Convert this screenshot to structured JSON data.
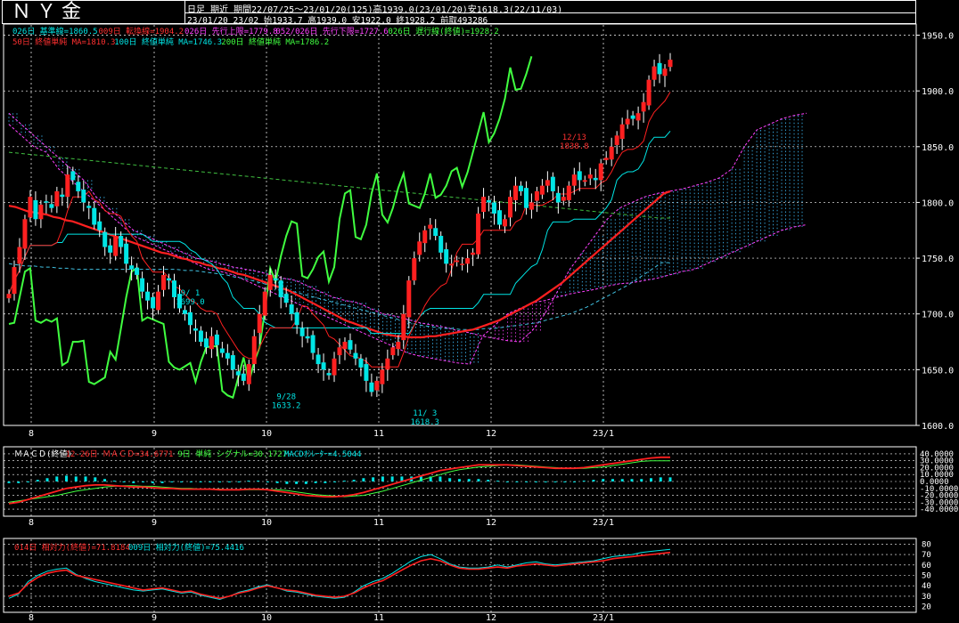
{
  "header": {
    "title": "ＮＹ金",
    "line1": "日足 期近 期間22/07/25～23/01/20(125)高1939.0(23/01/20)安1618.3(22/11/03)",
    "line2": "23/01/20 23/02 始1933.7 高1939.0 安1922.0 終1928.2 前取493286"
  },
  "main_legend": {
    "row1": [
      {
        "text": "026日 基準線=1860.5",
        "color": "#00e5e5"
      },
      {
        "text": "009日 転換線=1904.2",
        "color": "#ff3030"
      },
      {
        "text": "026日 先行上限=1779.8",
        "color": "#ff40ff"
      },
      {
        "text": "052/026日 先行下限=1727.6",
        "color": "#ff40ff"
      },
      {
        "text": "026日 遅行線(終値)=1928.2",
        "color": "#40ff40"
      }
    ],
    "row2": [
      {
        "text": "50日 終値単純 MA=1810.3",
        "color": "#ff3030"
      },
      {
        "text": "100日 終値単純 MA=1746.3",
        "color": "#00e5e5"
      },
      {
        "text": "200日 終値単純 MA=1786.2",
        "color": "#40ff40"
      }
    ]
  },
  "annotations": [
    {
      "text": "12/13",
      "sub": "1838.8",
      "color": "#ff3030",
      "date": "12/13",
      "price": 1838.8
    },
    {
      "text": "9/ 1",
      "sub": "1699.0",
      "color": "#00e5e5",
      "date": "9/1",
      "price": 1699.0
    },
    {
      "text": "9/28",
      "sub": "1633.2",
      "color": "#00e5e5",
      "date": "9/28",
      "price": 1633.2
    },
    {
      "text": "11/ 3",
      "sub": "1618.3",
      "color": "#00e5e5",
      "date": "11/3",
      "price": 1618.3
    }
  ],
  "macd_legend": [
    {
      "text": "ＭＡＣＤ(終値)",
      "color": "#ffffff"
    },
    {
      "text": "12-26日 ＭＡＣＤ=34.6771",
      "color": "#ff3030"
    },
    {
      "text": "9日 単純 シグナル=30.1727",
      "color": "#40ff40"
    },
    {
      "text": "MACDｵｼﾚｰﾀｰ=4.5044",
      "color": "#00e5e5"
    }
  ],
  "rsi_legend": [
    {
      "text": "014日 相対力(終値)=71.8184",
      "color": "#ff3030"
    },
    {
      "text": "009日 相対力(終値)=75.4416",
      "color": "#00e5e5"
    }
  ],
  "colors": {
    "up": "#ff2020",
    "down": "#00e5e5",
    "cloud": "#ff40ff",
    "lag": "#40ff40",
    "grid": "#ffffff"
  },
  "chart_data": [
    {
      "type": "candlestick",
      "title": "ＮＹ金",
      "x_ticks": [
        "8",
        "9",
        "10",
        "11",
        "12",
        "23/1"
      ],
      "y_ticks": [
        "1950.0",
        "1900.0",
        "1850.0",
        "1800.0",
        "1750.0",
        "1700.0",
        "1650.0",
        "1600.0"
      ],
      "ylim": [
        1600,
        1960
      ],
      "closes": [
        1718,
        1742,
        1760,
        1785,
        1805,
        1785,
        1798,
        1800,
        1795,
        1810,
        1805,
        1825,
        1820,
        1810,
        1800,
        1795,
        1780,
        1775,
        1760,
        1755,
        1770,
        1760,
        1745,
        1740,
        1735,
        1720,
        1712,
        1705,
        1720,
        1735,
        1730,
        1715,
        1705,
        1700,
        1690,
        1685,
        1675,
        1670,
        1680,
        1672,
        1665,
        1660,
        1650,
        1645,
        1640,
        1655,
        1680,
        1700,
        1720,
        1735,
        1730,
        1715,
        1710,
        1700,
        1690,
        1680,
        1678,
        1665,
        1655,
        1650,
        1645,
        1660,
        1670,
        1675,
        1668,
        1660,
        1652,
        1640,
        1630,
        1640,
        1650,
        1660,
        1670,
        1675,
        1700,
        1730,
        1750,
        1765,
        1775,
        1780,
        1770,
        1755,
        1745,
        1745,
        1748,
        1745,
        1750,
        1755,
        1790,
        1805,
        1800,
        1790,
        1780,
        1785,
        1805,
        1815,
        1810,
        1795,
        1800,
        1810,
        1815,
        1820,
        1810,
        1800,
        1805,
        1815,
        1825,
        1820,
        1820,
        1825,
        1820,
        1835,
        1840,
        1850,
        1860,
        1870,
        1875,
        1875,
        1880,
        1890,
        1910,
        1922,
        1915,
        1920,
        1928
      ],
      "ma50": [
        1797,
        1796,
        1794,
        1792,
        1791,
        1790,
        1789,
        1787,
        1786,
        1784,
        1783,
        1781,
        1779,
        1777,
        1775,
        1773,
        1771,
        1769,
        1767,
        1765,
        1763,
        1761,
        1759,
        1757,
        1755,
        1754,
        1752,
        1750,
        1749,
        1747,
        1746,
        1744,
        1743,
        1741,
        1740,
        1738,
        1736,
        1735,
        1733,
        1731,
        1729,
        1727,
        1725,
        1723,
        1721,
        1718,
        1715,
        1712,
        1709,
        1706,
        1703,
        1700,
        1697,
        1694,
        1692,
        1690,
        1688,
        1686,
        1684,
        1682,
        1681,
        1680,
        1680,
        1679,
        1679,
        1679,
        1680,
        1680,
        1681,
        1682,
        1683,
        1684,
        1685,
        1686,
        1688,
        1690,
        1692,
        1694,
        1697,
        1700,
        1703,
        1706,
        1709,
        1712,
        1716,
        1720,
        1724,
        1728,
        1733,
        1738,
        1743,
        1748,
        1753,
        1758,
        1763,
        1768,
        1773,
        1778,
        1783,
        1788,
        1793,
        1798,
        1803,
        1808,
        1810
      ],
      "ma100": [
        1745,
        1744,
        1743,
        1743,
        1742,
        1742,
        1741,
        1741,
        1740,
        1740,
        1740,
        1740,
        1740,
        1740,
        1740,
        1740,
        1740,
        1740,
        1740,
        1740,
        1740,
        1739,
        1739,
        1738,
        1737,
        1736,
        1735,
        1733,
        1732,
        1730,
        1728,
        1726,
        1724,
        1722,
        1720,
        1718,
        1716,
        1714,
        1712,
        1710,
        1708,
        1706,
        1704,
        1702,
        1700,
        1698,
        1696,
        1694,
        1692,
        1690,
        1689,
        1688,
        1687,
        1687,
        1686,
        1686,
        1686,
        1687,
        1687,
        1688,
        1689,
        1690,
        1691,
        1692,
        1694,
        1696,
        1698,
        1700,
        1703,
        1706,
        1710,
        1714,
        1718,
        1722,
        1726,
        1731,
        1736,
        1741,
        1746,
        1746
      ],
      "ma200": [
        1845,
        1844,
        1843,
        1842,
        1841,
        1840,
        1839,
        1838,
        1837,
        1836,
        1835,
        1834,
        1833,
        1832,
        1831,
        1830,
        1829,
        1828,
        1827,
        1826,
        1825,
        1824,
        1823,
        1822,
        1821,
        1820,
        1819,
        1818,
        1817,
        1816,
        1815,
        1814,
        1813,
        1812,
        1811,
        1810,
        1809,
        1808,
        1807,
        1806,
        1805,
        1804,
        1803,
        1802,
        1801,
        1800,
        1799,
        1798,
        1797,
        1796,
        1795,
        1794,
        1793,
        1792,
        1791,
        1790,
        1789,
        1788,
        1787,
        1786,
        1786
      ],
      "cloud_a": [
        1880,
        1870,
        1860,
        1850,
        1840,
        1830,
        1820,
        1805,
        1795,
        1785,
        1775,
        1770,
        1765,
        1760,
        1755,
        1750,
        1748,
        1745,
        1742,
        1740,
        1738,
        1735,
        1732,
        1730,
        1725,
        1720,
        1715,
        1712,
        1710,
        1705,
        1700,
        1698,
        1695,
        1692,
        1690,
        1688,
        1685,
        1683,
        1680,
        1678,
        1676,
        1675,
        1685,
        1700,
        1720,
        1740,
        1755,
        1770,
        1785,
        1795,
        1800,
        1805,
        1808,
        1810,
        1812,
        1815,
        1818,
        1822,
        1830,
        1850,
        1865,
        1870,
        1875,
        1878,
        1880
      ],
      "cloud_b": [
        1870,
        1860,
        1850,
        1845,
        1830,
        1820,
        1810,
        1800,
        1790,
        1780,
        1770,
        1765,
        1760,
        1755,
        1750,
        1745,
        1740,
        1738,
        1735,
        1730,
        1725,
        1720,
        1715,
        1710,
        1705,
        1700,
        1695,
        1690,
        1685,
        1680,
        1675,
        1670,
        1665,
        1662,
        1660,
        1658,
        1656,
        1655,
        1680,
        1690,
        1700,
        1705,
        1710,
        1712,
        1715,
        1718,
        1720,
        1722,
        1725,
        1727,
        1728,
        1730,
        1732,
        1735,
        1738,
        1740,
        1745,
        1750,
        1755,
        1760,
        1765,
        1770,
        1775,
        1778,
        1780
      ]
    },
    {
      "type": "line",
      "title": "ＭＡＣＤ(終値)",
      "y_ticks": [
        "40.0000",
        "30.0000",
        "20.0000",
        "10.0000",
        "0.0000",
        "-10.0000",
        "-20.0000",
        "-30.0000",
        "-40.0000"
      ],
      "ylim": [
        -45,
        45
      ],
      "series": [
        {
          "name": "12-26日 ＭＡＣＤ",
          "values": [
            -32,
            -30,
            -26,
            -22,
            -18,
            -14,
            -10,
            -8,
            -6,
            -5,
            -5,
            -6,
            -7,
            -8,
            -8,
            -9,
            -10,
            -10,
            -11,
            -11,
            -11,
            -11,
            -12,
            -12,
            -12,
            -11,
            -11,
            -12,
            -14,
            -16,
            -18,
            -20,
            -21,
            -22,
            -22,
            -21,
            -19,
            -16,
            -12,
            -8,
            -4,
            0,
            4,
            8,
            12,
            16,
            18,
            20,
            22,
            24,
            24,
            24,
            24,
            23,
            22,
            21,
            20,
            19,
            19,
            19,
            20,
            22,
            24,
            26,
            28,
            30,
            32,
            34,
            35,
            35
          ]
        },
        {
          "name": "9日 単純 シグナル",
          "values": [
            -30,
            -28,
            -26,
            -24,
            -22,
            -20,
            -17,
            -14,
            -12,
            -10,
            -8,
            -7,
            -6,
            -6,
            -7,
            -7,
            -8,
            -9,
            -10,
            -10,
            -11,
            -11,
            -11,
            -12,
            -12,
            -12,
            -12,
            -12,
            -12,
            -13,
            -15,
            -17,
            -19,
            -20,
            -21,
            -22,
            -21,
            -20,
            -17,
            -14,
            -10,
            -6,
            -2,
            2,
            6,
            10,
            14,
            17,
            19,
            21,
            22,
            23,
            24,
            24,
            23,
            22,
            21,
            20,
            19,
            19,
            19,
            20,
            21,
            23,
            25,
            27,
            29,
            30,
            30,
            30
          ]
        }
      ]
    },
    {
      "type": "line",
      "title": "相対力",
      "y_ticks": [
        "80",
        "70",
        "60",
        "50",
        "40",
        "30",
        "20"
      ],
      "ylim": [
        18,
        82
      ],
      "series": [
        {
          "name": "014日 相対力(終値)",
          "values": [
            30,
            33,
            42,
            48,
            52,
            54,
            55,
            50,
            48,
            46,
            44,
            42,
            40,
            38,
            36,
            37,
            38,
            36,
            34,
            35,
            32,
            30,
            28,
            30,
            33,
            35,
            38,
            40,
            38,
            36,
            35,
            33,
            31,
            30,
            29,
            30,
            33,
            38,
            42,
            45,
            50,
            55,
            60,
            64,
            66,
            64,
            60,
            57,
            56,
            56,
            57,
            58,
            57,
            59,
            60,
            61,
            60,
            59,
            60,
            61,
            62,
            63,
            64,
            66,
            67,
            68,
            69,
            70,
            71,
            72
          ]
        },
        {
          "name": "009日 相対力(終値)",
          "values": [
            28,
            32,
            44,
            50,
            54,
            56,
            57,
            51,
            47,
            44,
            42,
            40,
            38,
            36,
            35,
            36,
            37,
            35,
            33,
            34,
            31,
            29,
            27,
            30,
            34,
            36,
            39,
            41,
            38,
            35,
            34,
            32,
            30,
            29,
            28,
            29,
            34,
            40,
            44,
            47,
            52,
            58,
            64,
            68,
            70,
            66,
            61,
            58,
            57,
            57,
            58,
            60,
            58,
            60,
            62,
            63,
            61,
            60,
            61,
            62,
            63,
            64,
            66,
            68,
            69,
            70,
            72,
            73,
            74,
            75
          ]
        }
      ]
    }
  ]
}
